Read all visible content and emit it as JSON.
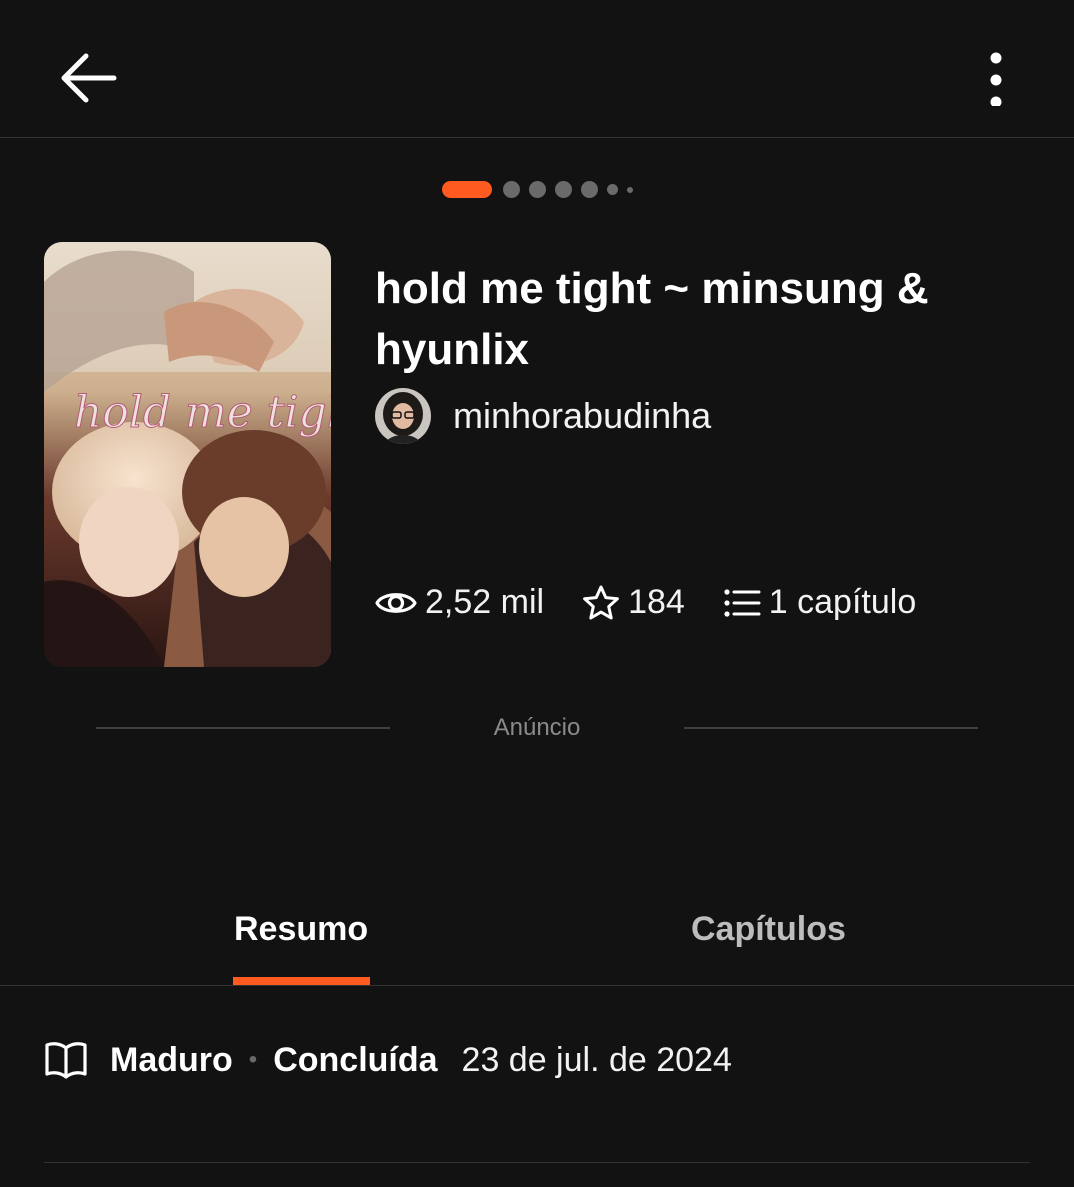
{
  "header": {
    "back_icon": "arrow-left-icon",
    "more_icon": "more-vertical-icon"
  },
  "carousel": {
    "active_color": "#ff5a1f",
    "total_dots": 7,
    "active_index": 0
  },
  "story": {
    "cover_text": "hold me tight",
    "title": "hold me tight ~ minsung & hyunlix",
    "author": "minhorabudinha",
    "stats": {
      "reads": "2,52 mil",
      "votes": "184",
      "parts": "1 capítulo"
    }
  },
  "ad": {
    "label": "Anúncio"
  },
  "tabs": [
    {
      "label": "Resumo",
      "active": true
    },
    {
      "label": "Capítulos",
      "active": false
    }
  ],
  "meta": {
    "rating": "Maduro",
    "separator": "•",
    "status": "Concluída",
    "date": "23 de jul. de 2024"
  },
  "colors": {
    "accent": "#ff5a1f",
    "background": "#121212",
    "divider": "#333333"
  }
}
